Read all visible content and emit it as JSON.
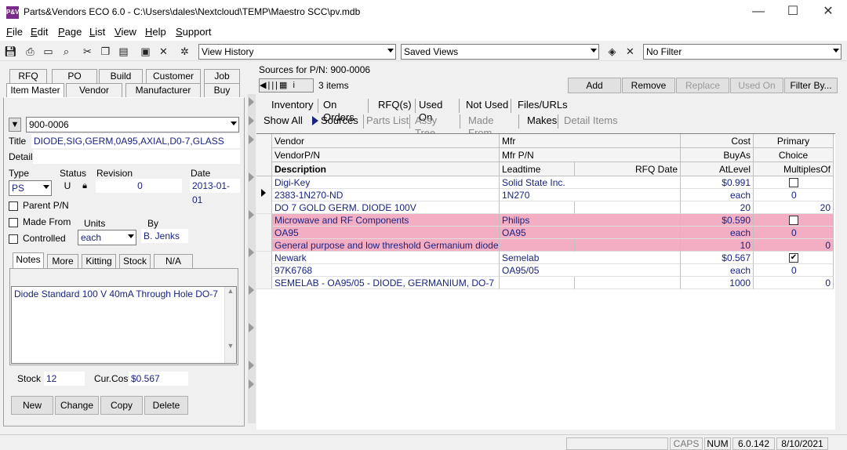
{
  "window": {
    "title": "Parts&Vendors ECO 6.0 - C:\\Users\\dales\\Nextcloud\\TEMP\\Maestro SCC\\pv.mdb",
    "min": "—",
    "max": "☐",
    "close": "✕",
    "icon": "P&V"
  },
  "menu": [
    "File",
    "Edit",
    "Page",
    "List",
    "View",
    "Help",
    "Support"
  ],
  "toolbar": {
    "view_history": "View History",
    "saved_views": "Saved Views",
    "filter": "No Filter"
  },
  "left_tabs": {
    "row1": [
      "RFQ",
      "PO",
      "Build",
      "Customer",
      "Job"
    ],
    "row2": [
      "Item Master",
      "Vendor",
      "Manufacturer",
      "Buy"
    ]
  },
  "item": {
    "pn": "900-0006",
    "title_label": "Title",
    "title": "DIODE,SIG,GERM,0A95,AXIAL,D0-7,GLASS",
    "detail_label": "Detail",
    "detail": "",
    "type_label": "Type",
    "type": "PS",
    "status_label": "Status",
    "status": "U",
    "revision_label": "Revision",
    "revision": "0",
    "date_label": "Date",
    "date": "2013-01-01",
    "parent_label": "Parent P/N",
    "made_from_label": "Made From",
    "controlled_label": "Controlled",
    "units_label": "Units",
    "units": "each",
    "by_label": "By",
    "by": "B. Jenks"
  },
  "sub_tabs": [
    "Notes",
    "More",
    "Kitting",
    "Stock",
    "N/A"
  ],
  "notes": "Diode Standard 100 V 40mA Through Hole DO-7",
  "stock_label": "Stock",
  "stock": "12",
  "curcost_label": "Cur.Cost",
  "curcost": "$0.567",
  "buttons": {
    "new": "New",
    "change": "Change",
    "copy": "Copy",
    "delete": "Delete"
  },
  "sources": {
    "header": "Sources for P/N: 900-0006",
    "count": "3 items",
    "add": "Add",
    "remove": "Remove",
    "replace": "Replace",
    "used_on": "Used On",
    "filter_by": "Filter By..."
  },
  "right_tabs1": [
    "Inventory",
    "On Orders",
    "RFQ(s)",
    "Used On",
    "Not Used",
    "Files/URLs"
  ],
  "right_tabs2": [
    "Show All",
    "Sources",
    "Parts List",
    "Assy Tree",
    "Made From",
    "Makes",
    "Detail Items"
  ],
  "columns": {
    "vendor": "Vendor",
    "mfr": "Mfr",
    "cost": "Cost",
    "primary": "Primary",
    "vendorpn": "VendorP/N",
    "mfrpn": "Mfr P/N",
    "buyas": "BuyAs",
    "choice": "Choice",
    "description": "Description",
    "leadtime": "Leadtime",
    "rfqdate": "RFQ Date",
    "atlevel": "AtLevel",
    "multiplesof": "MultiplesOf"
  },
  "rows": [
    {
      "vendor": "Digi-Key",
      "mfr": "Solid State Inc.",
      "cost": "$0.991",
      "primary": false,
      "vendorpn": "2383-1N270-ND",
      "mfrpn": "1N270",
      "buyas": "each",
      "choice": "0",
      "description": "DO 7 GOLD GERM. DIODE 100V",
      "leadtime": "",
      "rfqdate": "",
      "atlevel": "20",
      "multiplesof": "20"
    },
    {
      "vendor": "Microwave and RF Components",
      "mfr": "Philips",
      "cost": "$0.590",
      "primary": false,
      "vendorpn": "OA95",
      "mfrpn": "OA95",
      "buyas": "each",
      "choice": "0",
      "description": "General purpose and low threshold Germanium diode",
      "leadtime": "",
      "rfqdate": "",
      "atlevel": "10",
      "multiplesof": "0"
    },
    {
      "vendor": "Newark",
      "mfr": "Semelab",
      "cost": "$0.567",
      "primary": true,
      "vendorpn": "97K6768",
      "mfrpn": "OA95/05",
      "buyas": "each",
      "choice": "0",
      "description": "SEMELAB - OA95/05 - DIODE, GERMANIUM, DO-7",
      "leadtime": "",
      "rfqdate": "",
      "atlevel": "1000",
      "multiplesof": "0"
    }
  ],
  "status": {
    "caps": "CAPS",
    "num": "NUM",
    "version": "6.0.142",
    "date": "8/10/2021"
  }
}
